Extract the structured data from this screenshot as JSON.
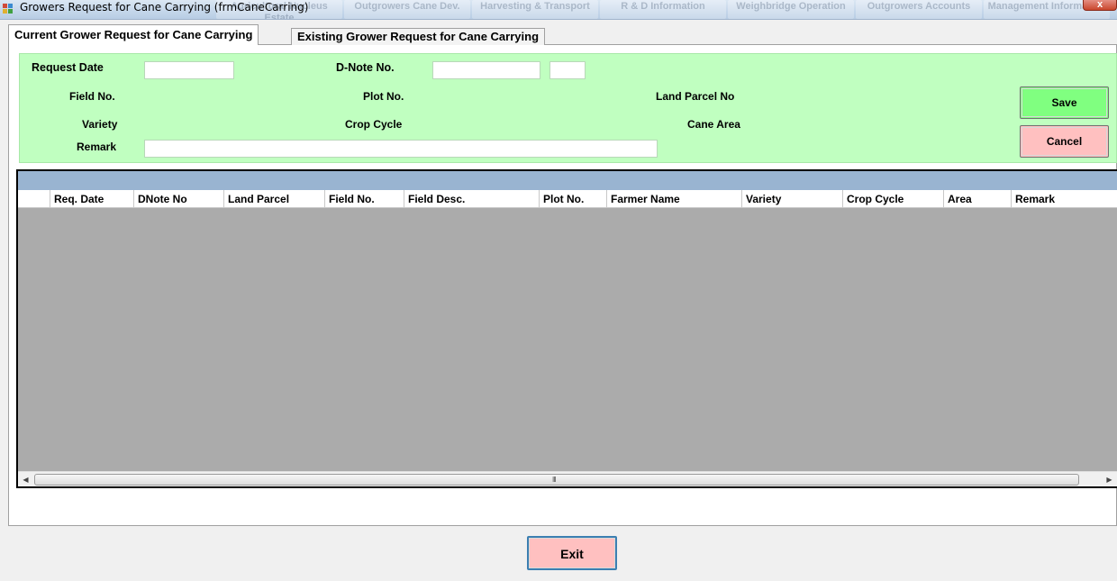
{
  "window": {
    "title": "Growers Request for Cane Carrying (frmCaneCarring)",
    "close_label": "x",
    "background_menu": [
      "Agricultural Nucleus Estate",
      "Outgrowers Cane Dev.",
      "Harvesting & Transport",
      "R & D Information",
      "Weighbridge Operation",
      "Outgrowers Accounts",
      "Management Information"
    ]
  },
  "tabs": [
    {
      "label": "Current Grower Request for Cane Carrying"
    },
    {
      "label": "Existing Grower Request for Cane Carrying"
    }
  ],
  "form": {
    "request_date_label": "Request Date",
    "request_date_value": "",
    "dnote_label": "D-Note No.",
    "dnote_value": "",
    "dnote_extra_value": "",
    "field_no_label": "Field No.",
    "plot_no_label": "Plot No.",
    "land_parcel_label": "Land Parcel No",
    "variety_label": "Variety",
    "crop_cycle_label": "Crop Cycle",
    "cane_area_label": "Cane Area",
    "remark_label": "Remark",
    "remark_value": "",
    "save_label": "Save",
    "cancel_label": "Cancel"
  },
  "grid": {
    "columns": [
      "Req. Date",
      "DNote No",
      "Land Parcel",
      "Field No.",
      "Field Desc.",
      "Plot No.",
      "Farmer Name",
      "Variety",
      "Crop Cycle",
      "Area",
      "Remark"
    ],
    "rows": [],
    "scroll_grip": "III"
  },
  "footer": {
    "exit_label": "Exit"
  },
  "colors": {
    "form_panel": "#c0ffc0",
    "save_button": "#80ff80",
    "cancel_button": "#ffc0c0",
    "grid_band": "#99b4d1",
    "grid_body": "#ababab"
  }
}
